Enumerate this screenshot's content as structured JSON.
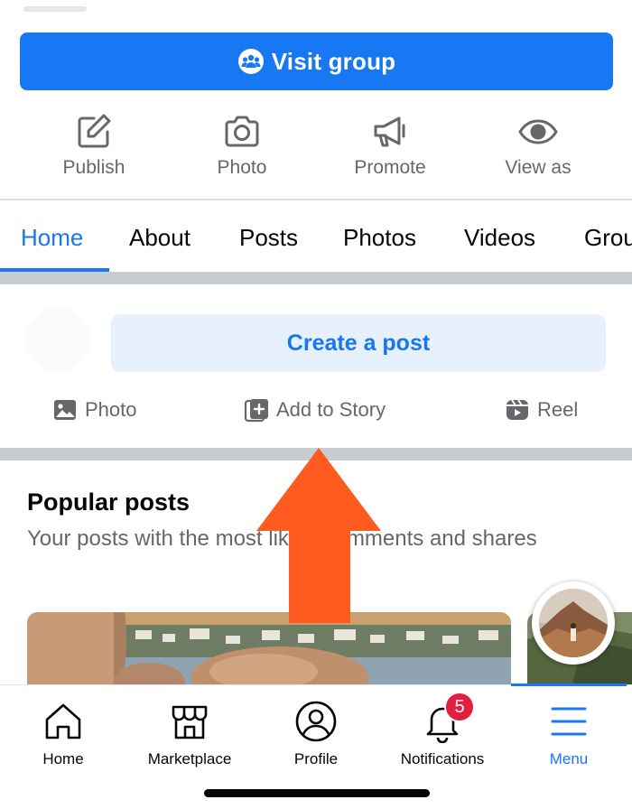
{
  "header": {
    "visit_group_label": "Visit group"
  },
  "actions": [
    {
      "label": "Publish",
      "icon": "edit-icon"
    },
    {
      "label": "Photo",
      "icon": "camera-icon"
    },
    {
      "label": "Promote",
      "icon": "megaphone-icon"
    },
    {
      "label": "View as",
      "icon": "eye-icon"
    }
  ],
  "tabs": [
    "Home",
    "About",
    "Posts",
    "Photos",
    "Videos",
    "Grou"
  ],
  "active_tab": "Home",
  "composer": {
    "create_post_label": "Create a post",
    "options": [
      {
        "label": "Photo",
        "icon": "photo-icon"
      },
      {
        "label": "Add to Story",
        "icon": "add-story-icon"
      },
      {
        "label": "Reel",
        "icon": "reel-icon"
      }
    ]
  },
  "popular": {
    "title": "Popular posts",
    "subtitle": "Your posts with the most likes, comments and shares"
  },
  "bottom_nav": {
    "items": [
      {
        "label": "Home",
        "icon": "home-icon"
      },
      {
        "label": "Marketplace",
        "icon": "marketplace-icon"
      },
      {
        "label": "Profile",
        "icon": "profile-icon"
      },
      {
        "label": "Notifications",
        "icon": "bell-icon"
      },
      {
        "label": "Menu",
        "icon": "hamburger-icon"
      }
    ],
    "notifications_badge": "5",
    "active": "Menu"
  },
  "colors": {
    "accent": "#1877f2",
    "annotation_arrow": "#ff5a1f",
    "badge": "#e41e3f"
  }
}
